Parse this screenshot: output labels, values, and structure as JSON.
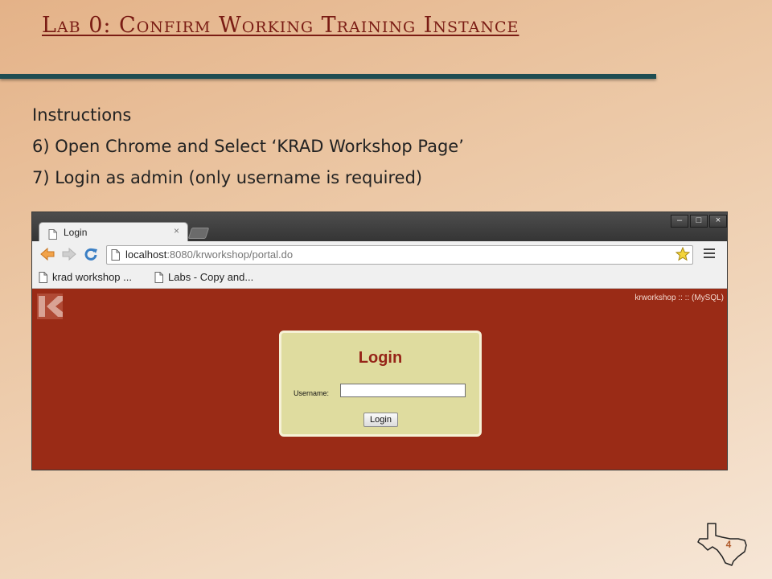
{
  "slide": {
    "title": "Lab 0: Confirm Working Training Instance",
    "instructions": [
      "Instructions",
      "6) Open Chrome and Select ‘KRAD Workshop Page’",
      "7) Login as admin (only username is required)"
    ],
    "page_number": "4"
  },
  "browser": {
    "tab_label": "Login",
    "tab_close": "×",
    "window_buttons": [
      "–",
      "□",
      "×"
    ],
    "url_host": "localhost",
    "url_rest": ":8080/krworkshop/portal.do",
    "bookmarks": [
      "krad workshop ...",
      "Labs - Copy and..."
    ]
  },
  "app": {
    "info": "krworkshop :: :: (MySQL)",
    "login_title": "Login",
    "username_label": "Username:",
    "username_value": "",
    "login_button": "Login"
  },
  "colors": {
    "title": "#7a1c14",
    "rule": "#1f4d52",
    "app_background": "#9a2b16",
    "login_box": "#dfdc9f",
    "login_title": "#962418"
  }
}
